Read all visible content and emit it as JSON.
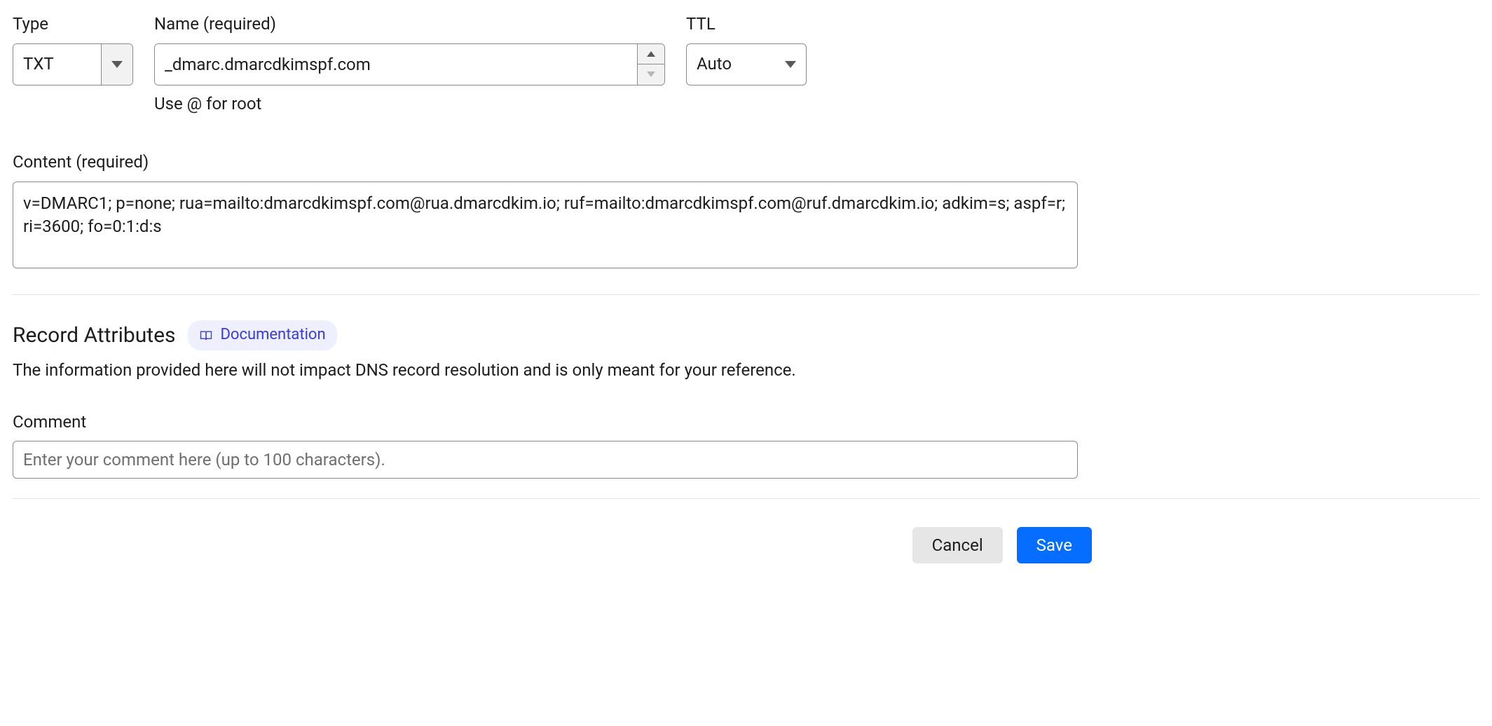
{
  "labels": {
    "type": "Type",
    "name": "Name (required)",
    "ttl": "TTL",
    "name_hint": "Use @ for root",
    "content": "Content (required)",
    "record_attributes_heading": "Record Attributes",
    "documentation": "Documentation",
    "record_attributes_desc": "The information provided here will not impact DNS record resolution and is only meant for your reference.",
    "comment": "Comment"
  },
  "fields": {
    "type_value": "TXT",
    "name_value": "_dmarc.dmarcdkimspf.com",
    "ttl_value": "Auto",
    "content_value": "v=DMARC1; p=none; rua=mailto:dmarcdkimspf.com@rua.dmarcdkim.io; ruf=mailto:dmarcdkimspf.com@ruf.dmarcdkim.io; adkim=s; aspf=r; ri=3600; fo=0:1:d:s",
    "comment_value": "",
    "comment_placeholder": "Enter your comment here (up to 100 characters)."
  },
  "buttons": {
    "cancel": "Cancel",
    "save": "Save"
  }
}
